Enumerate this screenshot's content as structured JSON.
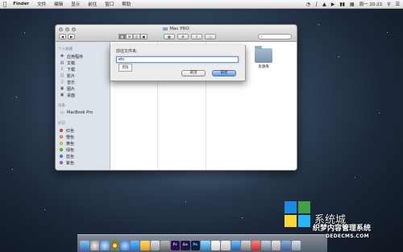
{
  "menubar": {
    "app_name": "Finder",
    "items": [
      "文件",
      "编辑",
      "显示",
      "前往",
      "窗口",
      "帮助"
    ],
    "clock": "周一 20:22",
    "search_icon": "search-icon"
  },
  "window": {
    "title": "Mac PRO",
    "sidebar": {
      "favorites_header": "个人收藏",
      "favorites": [
        {
          "label": "应用程序",
          "icon": "applications-icon"
        },
        {
          "label": "文稿",
          "icon": "documents-icon"
        },
        {
          "label": "下载",
          "icon": "downloads-icon"
        },
        {
          "label": "影片",
          "icon": "movies-icon"
        },
        {
          "label": "音乐",
          "icon": "music-icon"
        },
        {
          "label": "图片",
          "icon": "pictures-icon"
        },
        {
          "label": "桌面",
          "icon": "desktop-icon"
        }
      ],
      "devices_header": "设备",
      "devices": [
        {
          "label": "MacBook Pro",
          "icon": "laptop-icon"
        }
      ],
      "tags_header": "标记",
      "tags": [
        {
          "label": "红色",
          "color": "#e8524a"
        },
        {
          "label": "橙色",
          "color": "#f4a23a"
        },
        {
          "label": "黄色",
          "color": "#f3d64a"
        },
        {
          "label": "绿色",
          "color": "#6cc24a"
        },
        {
          "label": "蓝色",
          "color": "#4a90e2"
        },
        {
          "label": "紫色",
          "color": "#b06ad6"
        }
      ]
    },
    "content": {
      "library_folder_label": "资源库"
    }
  },
  "sheet": {
    "label": "前往文件夹:",
    "input_value": "etc",
    "suggestion": "EN",
    "cancel_label": "取消",
    "go_label": "前往"
  },
  "watermark": {
    "line1": "系统城",
    "line2": "织梦内容管理系统",
    "line3": "DEDECMS.COM"
  }
}
